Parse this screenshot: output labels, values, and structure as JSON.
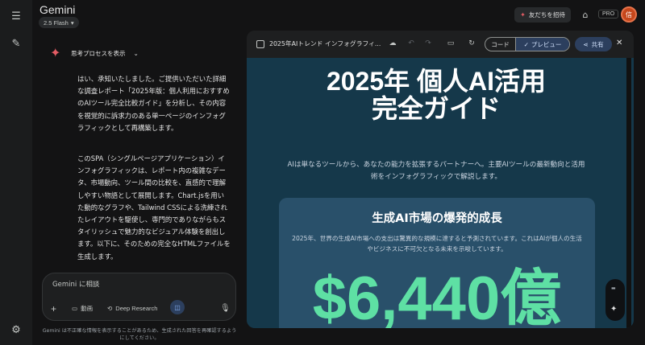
{
  "app": {
    "title": "Gemini",
    "model": "2.5 Flash"
  },
  "header": {
    "invite_label": "友だちを招待",
    "pro_label": "PRO",
    "avatar_initial": "信"
  },
  "chat": {
    "thinking_label": "思考プロセスを表示",
    "paragraph1": "はい、承知いたしました。ご提供いただいた詳細な調査レポート「2025年版：個人利用におすすめのAIツール完全比較ガイド」を分析し、その内容を視覚的に訴求力のある単一ページのインフォグラフィックとして再構築します。",
    "paragraph2": "このSPA（シングルページアプリケーション）インフォグラフィックは、レポート内の複雑なデータ、市場動向、ツール間の比較を、直感的で理解しやすい物語として展開します。Chart.jsを用いた動的なグラフや、Tailwind CSSによる洗練されたレイアウトを駆使し、専門的でありながらもスタイリッシュで魅力的なビジュアル体験を創出します。以下に、そのための完全なHTMLファイルを生成します。"
  },
  "composer": {
    "placeholder": "Gemini に相談",
    "video_label": "動画",
    "deep_research_label": "Deep Research"
  },
  "disclaimer": "Gemini は不正確な情報を表示することがあるため、生成された回答を再確認するようにしてください。",
  "canvas": {
    "doc_title": "2025年AIトレンド インフォグラフィ...",
    "code_tab": "コード",
    "preview_tab": "プレビュー",
    "share_label": "共有"
  },
  "preview": {
    "hero_title_line1": "2025年 個人AI活用",
    "hero_title_line2": "完全ガイド",
    "hero_subtitle": "AIは単なるツールから、あなたの能力を拡張するパートナーへ。主要AIツールの最新動向と活用術をインフォグラフィックで解説します。",
    "card_title": "生成AI市場の爆発的成長",
    "card_desc": "2025年、世界の生成AI市場への支出は驚異的な規模に達すると予測されています。これはAIが個人の生活やビジネスに不可欠となる未来を示唆しています。",
    "big_number": "$6,440億"
  }
}
